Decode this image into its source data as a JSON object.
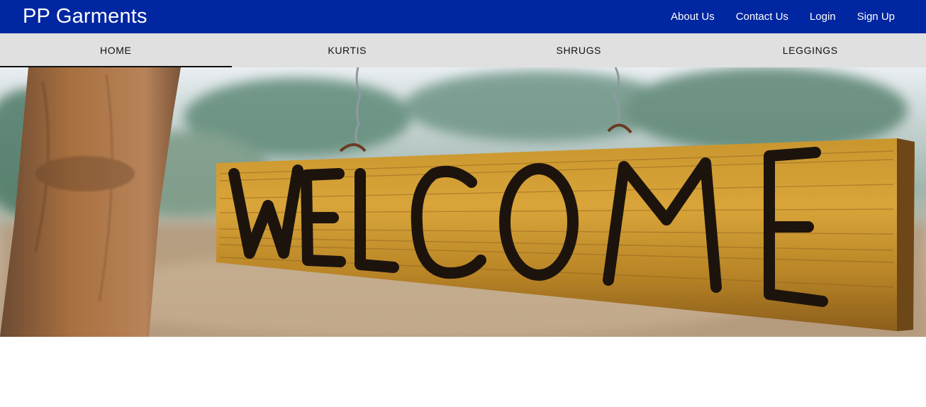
{
  "header": {
    "brand": "PP Garments",
    "links": [
      "About Us",
      "Contact Us",
      "Login",
      "Sign Up"
    ]
  },
  "tabs": [
    {
      "label": "HOME",
      "active": true
    },
    {
      "label": "KURTIS",
      "active": false
    },
    {
      "label": "SHRUGS",
      "active": false
    },
    {
      "label": "LEGGINGS",
      "active": false
    }
  ],
  "hero": {
    "sign_text": "WELCOME"
  },
  "colors": {
    "header_bg": "#0026a1",
    "tabs_bg": "#e0e0e0",
    "active_indicator": "#111111"
  }
}
